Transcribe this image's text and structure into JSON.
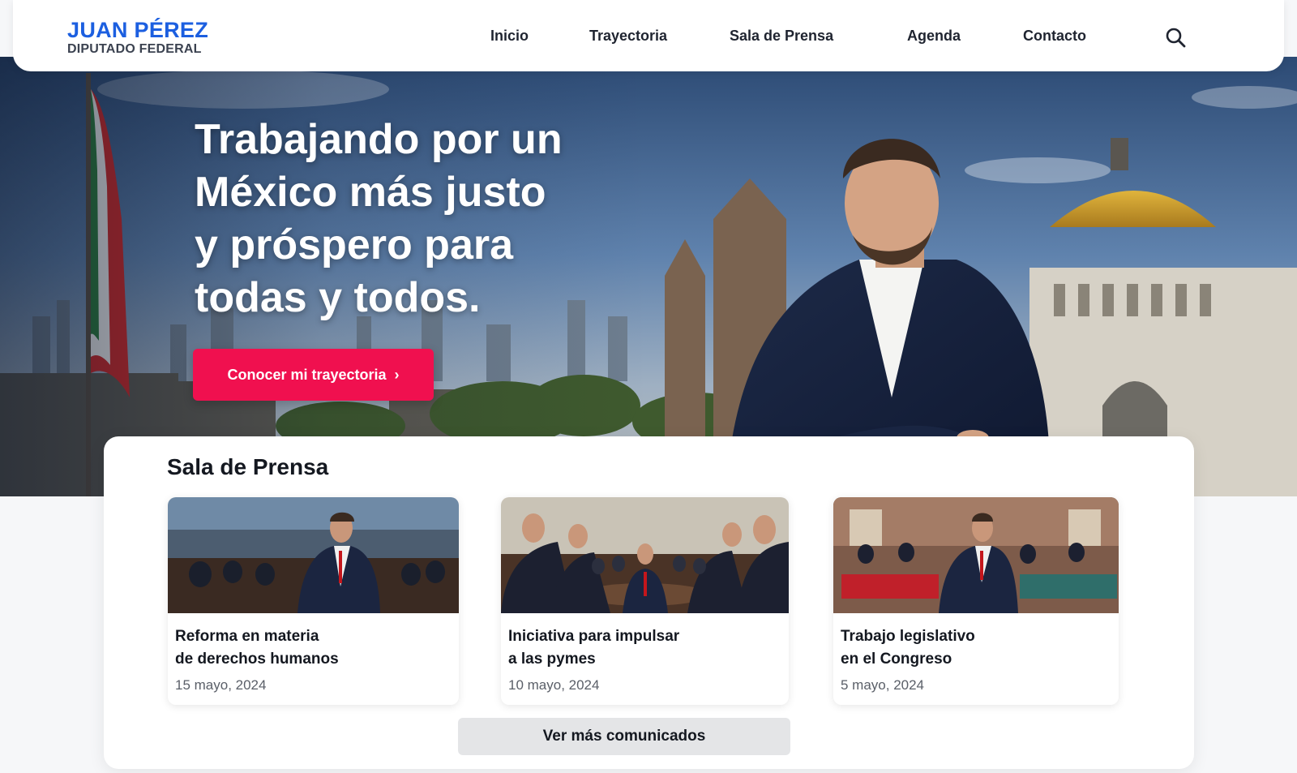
{
  "header": {
    "brand_name": "JUAN PÉREZ",
    "brand_role": "DIPUTADO FEDERAL",
    "nav": [
      {
        "label": "Inicio"
      },
      {
        "label": "Trayectoria"
      },
      {
        "label": "Sala de Prensa"
      },
      {
        "label": "Agenda"
      },
      {
        "label": "Contacto"
      }
    ],
    "search_icon": "search-icon"
  },
  "hero": {
    "headline": "Trabajando por un México más justo y próspero para todas y todos.",
    "cta_label": "Conocer mi trayectoria",
    "cta_icon": "chevron-right-icon",
    "accent_color": "#f0104f"
  },
  "press": {
    "title": "Sala de Prensa",
    "items": [
      {
        "title": "Reforma en materia\nde derechos humanos",
        "date": "15 mayo, 2024"
      },
      {
        "title": "Iniciativa para impulsar\na las pymes",
        "date": "10 mayo, 2024"
      },
      {
        "title": "Trabajo legislativo\nen el Congreso",
        "date": "5 mayo, 2024"
      }
    ],
    "more_label": "Ver más comunicados"
  },
  "colors": {
    "brand_blue": "#1c5fe0",
    "cta_pink": "#f0104f"
  }
}
